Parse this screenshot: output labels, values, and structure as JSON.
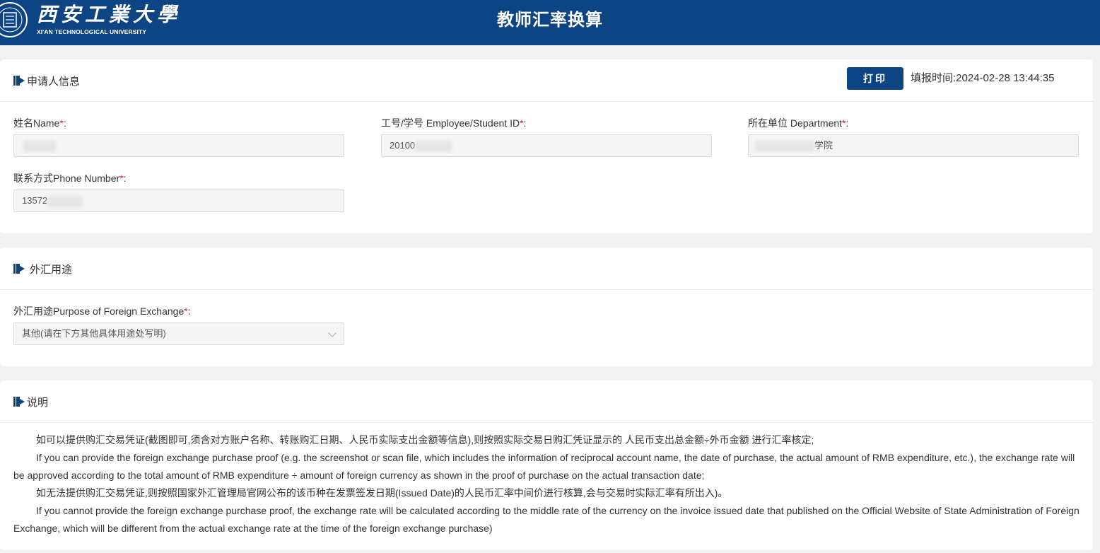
{
  "header": {
    "logo_cn": "西安工業大學",
    "logo_en": "XI'AN TECHNOLOGICAL UNIVERSITY",
    "title": "教师汇率换算",
    "bg_color": "#0d4483"
  },
  "applicant": {
    "section_title": "申请人信息",
    "print_label": "打印",
    "fill_time_label": "填报时间:",
    "fill_time_value": "2024-02-28 13:44:35",
    "name_label": "姓名Name",
    "name_value": "",
    "id_label": "工号/学号 Employee/Student ID",
    "id_value": "20100",
    "dept_label": "所在单位 Department",
    "dept_value": "学院",
    "phone_label": "联系方式Phone Number",
    "phone_value": "13572",
    "required_mark": "*",
    "colon": ":"
  },
  "purpose": {
    "section_title": "外汇用途",
    "field_label": "外汇用途Purpose of Foreign Exchange",
    "selected_option": "其他(请在下方其他具体用途处写明)"
  },
  "explanation": {
    "section_title": "说明",
    "para1": "如可以提供购汇交易凭证(截图即可,须含对方账户名称、转账购汇日期、人民币实际支出金额等信息),则按照实际交易日购汇凭证显示的 人民币支出总金额÷外币金额 进行汇率核定;",
    "para2": "If you can provide the foreign exchange purchase proof (e.g. the screenshot or scan file, which includes the information of reciprocal account name, the date of purchase, the actual amount of RMB expenditure, etc.), the exchange rate will be approved according to the total amount of RMB expenditure ÷ amount of foreign currency as shown in the proof of purchase on the actual transaction date;",
    "para3": "如无法提供购汇交易凭证,则按照国家外汇管理局官网公布的该币种在发票签发日期(Issued Date)的人民币汇率中间价进行核算,会与交易时实际汇率有所出入)。",
    "para4": "If you cannot provide the foreign exchange purchase proof, the exchange rate will be calculated according to the middle rate of the currency on the invoice issued date that published on the Official Website of State Administration of Foreign Exchange, which will be different from the actual exchange rate at the time of the foreign exchange purchase)"
  }
}
